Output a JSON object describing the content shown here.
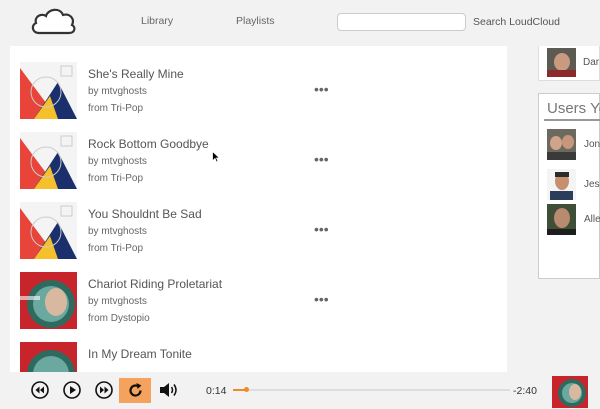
{
  "header": {
    "nav": [
      {
        "label": "Library"
      },
      {
        "label": "Playlists"
      }
    ],
    "search": {
      "placeholder": "",
      "value": "",
      "label": "Search LoudCloud"
    }
  },
  "tracks": [
    {
      "title": "She's Really Mine",
      "artist": "by mtvghosts",
      "album": "from Tri-Pop",
      "art": "tri-pop"
    },
    {
      "title": "Rock Bottom Goodbye",
      "artist": "by mtvghosts",
      "album": "from Tri-Pop",
      "art": "tri-pop"
    },
    {
      "title": "You Shouldnt Be Sad",
      "artist": "by mtvghosts",
      "album": "from Tri-Pop",
      "art": "tri-pop"
    },
    {
      "title": "Chariot Riding Proletariat",
      "artist": "by mtvghosts",
      "album": "from Dystopio",
      "art": "dystopio"
    },
    {
      "title": "In My Dream Tonite",
      "artist": "",
      "album": "",
      "art": "dystopio"
    }
  ],
  "sidebar": {
    "friend": {
      "name": "Dar"
    },
    "users_title": "Users Yo",
    "users": [
      {
        "name": "Jon"
      },
      {
        "name": "Jess"
      },
      {
        "name": "Alle"
      }
    ]
  },
  "player": {
    "elapsed": "0:14",
    "remaining": "-2:40",
    "progress_fraction": 0.05,
    "repeat_active": true,
    "colors": {
      "accent": "#f08a24",
      "repeat_bg": "#f5a35c"
    }
  }
}
